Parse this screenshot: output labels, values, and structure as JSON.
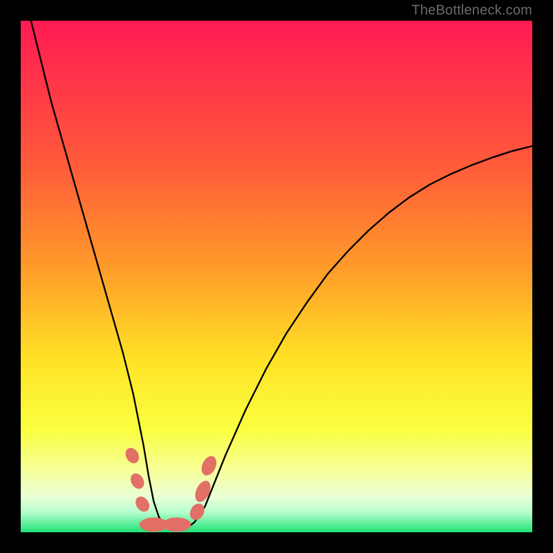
{
  "watermark": "TheBottleneck.com",
  "colors": {
    "frame": "#000000",
    "gradient_top": "#ff1a53",
    "gradient_mid_upper": "#ff8a2a",
    "gradient_mid": "#ffe126",
    "gradient_mid_lower": "#fbff68",
    "gradient_pale": "#f4ffd1",
    "gradient_bottom": "#1fe276",
    "curve": "#000000",
    "marker_fill": "#e27066",
    "marker_stroke": "#c35a52"
  },
  "chart_data": {
    "type": "line",
    "title": "",
    "xlabel": "",
    "ylabel": "",
    "x_range": [
      0,
      100
    ],
    "y_range": [
      0,
      100
    ],
    "curve": {
      "name": "bottleneck-curve",
      "x": [
        0,
        2,
        4,
        6,
        8,
        10,
        12,
        14,
        16,
        18,
        20,
        22,
        24,
        25,
        26,
        27,
        28,
        30,
        32,
        33,
        34,
        36,
        38,
        40,
        44,
        48,
        52,
        56,
        60,
        64,
        68,
        72,
        76,
        80,
        84,
        88,
        92,
        96,
        100
      ],
      "y": [
        108,
        100,
        92,
        84,
        77,
        70,
        63,
        56,
        49,
        42,
        35,
        27,
        17,
        11,
        6,
        3,
        1.5,
        1,
        1,
        1.2,
        2,
        5,
        10,
        15,
        24,
        32,
        39,
        45,
        50.5,
        55,
        59,
        62.5,
        65.5,
        68,
        70,
        71.7,
        73.2,
        74.5,
        75.5
      ]
    },
    "markers": [
      {
        "cx": 21.8,
        "cy": 15.0,
        "rx": 1.2,
        "ry": 1.6,
        "rot": -30
      },
      {
        "cx": 22.8,
        "cy": 10.0,
        "rx": 1.2,
        "ry": 1.6,
        "rot": -30
      },
      {
        "cx": 23.8,
        "cy": 5.5,
        "rx": 1.2,
        "ry": 1.6,
        "rot": -35
      },
      {
        "cx": 26.0,
        "cy": 1.5,
        "rx": 2.8,
        "ry": 1.4,
        "rot": 0
      },
      {
        "cx": 30.5,
        "cy": 1.5,
        "rx": 2.8,
        "ry": 1.4,
        "rot": 0
      },
      {
        "cx": 34.5,
        "cy": 4.0,
        "rx": 1.3,
        "ry": 1.7,
        "rot": 30
      },
      {
        "cx": 35.6,
        "cy": 8.0,
        "rx": 1.3,
        "ry": 2.2,
        "rot": 25
      },
      {
        "cx": 36.8,
        "cy": 13.0,
        "rx": 1.3,
        "ry": 2.0,
        "rot": 25
      }
    ],
    "annotations": []
  }
}
